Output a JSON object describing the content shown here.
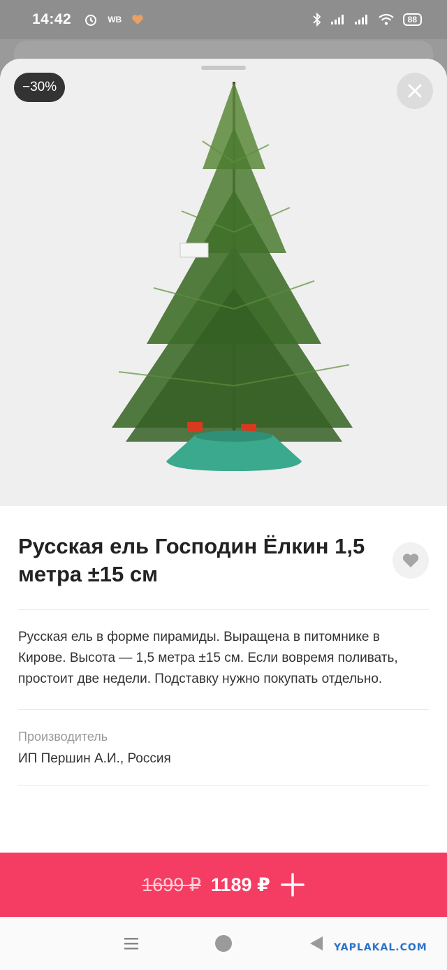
{
  "status_bar": {
    "time": "14:42",
    "carrier_badge": "WB",
    "battery": "88",
    "icons": [
      "alarm-icon",
      "wb-icon",
      "heart-app-icon",
      "bluetooth-icon",
      "signal-icon",
      "signal-icon",
      "wifi-icon",
      "battery-icon"
    ]
  },
  "product": {
    "discount_badge": "−30%",
    "title": "Русская ель Господин Ёлкин 1,5 метра ±15 см",
    "description": "Русская ель в форме пирамиды. Выращена в питомнике в Кирове. Высота — 1,5 метра ±15 см. Если вовремя поливать, простоит две недели. Подставку нужно покупать отдельно.",
    "manufacturer_label": "Производитель",
    "manufacturer_value": "ИП Першин А.И., Россия"
  },
  "buy_bar": {
    "old_price": "1699 ₽",
    "new_price": "1189 ₽",
    "action_icon": "plus-icon"
  },
  "watermark": "YAPLAKAL.COM",
  "colors": {
    "accent": "#f53d63",
    "badge_bg": "#333333",
    "tree_green": "#3d6b2a",
    "stand_teal": "#3aa98d"
  }
}
